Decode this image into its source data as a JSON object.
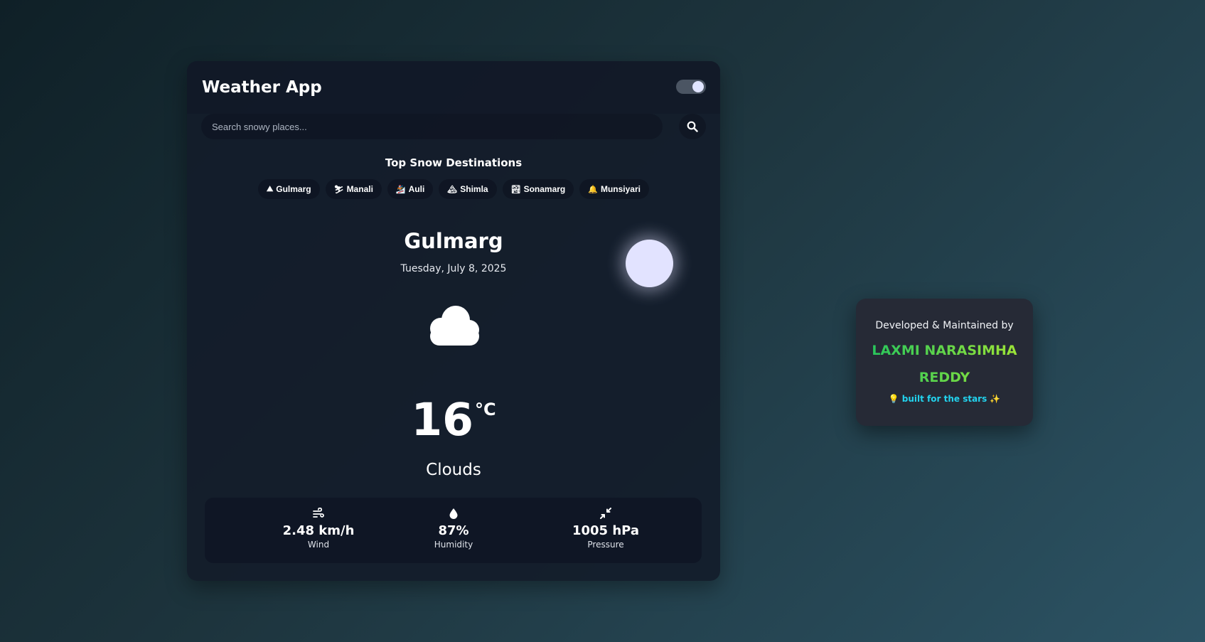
{
  "app": {
    "title": "Weather App",
    "theme_toggle": "on"
  },
  "search": {
    "placeholder": "Search snowy places...",
    "value": ""
  },
  "destinations": {
    "title": "Top Snow Destinations",
    "items": [
      {
        "icon": "⛰",
        "icon_name": "mountain-icon",
        "label": "Gulmarg"
      },
      {
        "icon": "⛷",
        "icon_name": "skier-icon",
        "label": "Manali"
      },
      {
        "icon": "🏂",
        "icon_name": "snowboarder-icon",
        "label": "Auli"
      },
      {
        "icon": "🏔",
        "icon_name": "igloo-icon",
        "label": "Shimla"
      },
      {
        "icon": "🏞",
        "icon_name": "hiker-icon",
        "label": "Sonamarg"
      },
      {
        "icon": "🔔",
        "icon_name": "bell-icon",
        "label": "Munsiyari"
      }
    ]
  },
  "weather": {
    "city": "Gulmarg",
    "date": "Tuesday, July 8, 2025",
    "temp": "16",
    "unit": "°C",
    "condition": "Clouds",
    "icon": "cloud-icon"
  },
  "stats": [
    {
      "icon": "wind-icon",
      "value": "2.48 km/h",
      "label": "Wind"
    },
    {
      "icon": "water-drop-icon",
      "value": "87%",
      "label": "Humidity"
    },
    {
      "icon": "compress-icon",
      "value": "1005 hPa",
      "label": "Pressure"
    }
  ],
  "credits": {
    "label": "Developed & Maintained by",
    "name": "LAXMI NARASIMHA REDDY",
    "tagline": "💡 built for the stars ✨"
  },
  "colors": {
    "background_start": "#0f2027",
    "background_end": "#2c5364",
    "card": "#131c2a",
    "moon": "#e2e3ff",
    "name_gradient_start": "#22c55e",
    "name_gradient_end": "#a3e635",
    "tagline": "#22d3ee"
  }
}
